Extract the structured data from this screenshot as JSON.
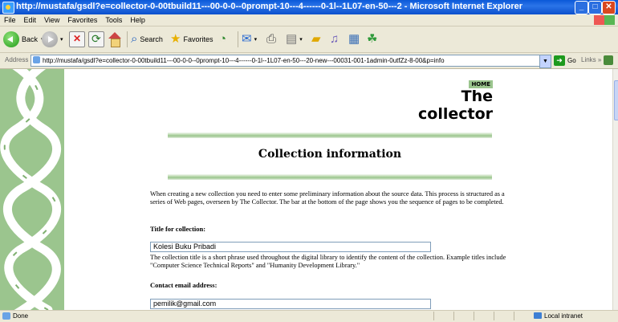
{
  "window": {
    "title": "http://mustafa/gsdl?e=collector-0-00tbuild11---00-0-0--0prompt-10---4------0-1l--1L07-en-50---2 - Microsoft Internet Explorer"
  },
  "menu": [
    "File",
    "Edit",
    "View",
    "Favorites",
    "Tools",
    "Help"
  ],
  "toolbar": {
    "back_label": "Back",
    "search_label": "Search",
    "favorites_label": "Favorites"
  },
  "address": {
    "label": "Address",
    "url": "http://mustafa/gsdl?e=collector-0-00tbuild11---00-0-0--0prompt-10---4------0-1l--1L07-en-50---20-new---00031-001-1admin-0utfZz-8-00&p=info",
    "go_label": "Go",
    "links_label": "Links"
  },
  "page": {
    "home_label": "HOME",
    "logo_line1": "The",
    "logo_line2": "collector",
    "title": "Collection information",
    "intro": "When creating a new collection you need to enter some preliminary information about the source data. This process is structured as a series of Web pages, overseen by The Collector. The bar at the bottom of the page shows you the sequence of pages to be completed.",
    "title_field_label": "Title for collection:",
    "title_field_value": "Kolesi Buku Pribadi",
    "title_help": "The collection title is a short phrase used throughout the digital library to identify the content of the collection. Example titles include \"Computer Science Technical Reports\" and \"Humanity Development Library.\"",
    "email_field_label": "Contact email address:",
    "email_field_value": "pemilik@gmail.com"
  },
  "status": {
    "text": "Done",
    "zone": "Local intranet"
  },
  "colors": {
    "accent_green": "#9bc58e",
    "titlebar_blue": "#0a58d8"
  }
}
